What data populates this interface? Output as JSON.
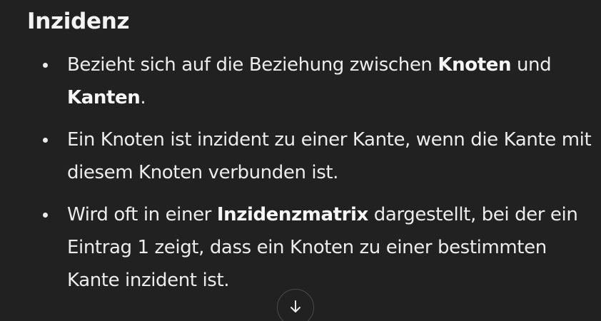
{
  "section": {
    "heading": "Inzidenz",
    "bullets": [
      {
        "parts": [
          {
            "text": "Bezieht sich auf die Beziehung zwischen ",
            "bold": false
          },
          {
            "text": "Knoten",
            "bold": true
          },
          {
            "text": " und ",
            "bold": false
          },
          {
            "text": "Kanten",
            "bold": true
          },
          {
            "text": ".",
            "bold": false
          }
        ]
      },
      {
        "parts": [
          {
            "text": "Ein Knoten ist inzident zu einer Kante, wenn die Kante mit diesem Knoten verbunden ist.",
            "bold": false
          }
        ]
      },
      {
        "parts": [
          {
            "text": "Wird oft in einer ",
            "bold": false
          },
          {
            "text": "Inzidenzmatrix",
            "bold": true
          },
          {
            "text": " dargestellt, bei der ein Eintrag 1 zeigt, dass ein Knoten zu einer bestimmten Kante inzident ist.",
            "bold": false
          }
        ]
      }
    ]
  },
  "scroll_button": {
    "icon": "arrow-down-icon"
  },
  "colors": {
    "background": "#212121",
    "text": "#ececec",
    "button_border": "#4a4a4a"
  }
}
